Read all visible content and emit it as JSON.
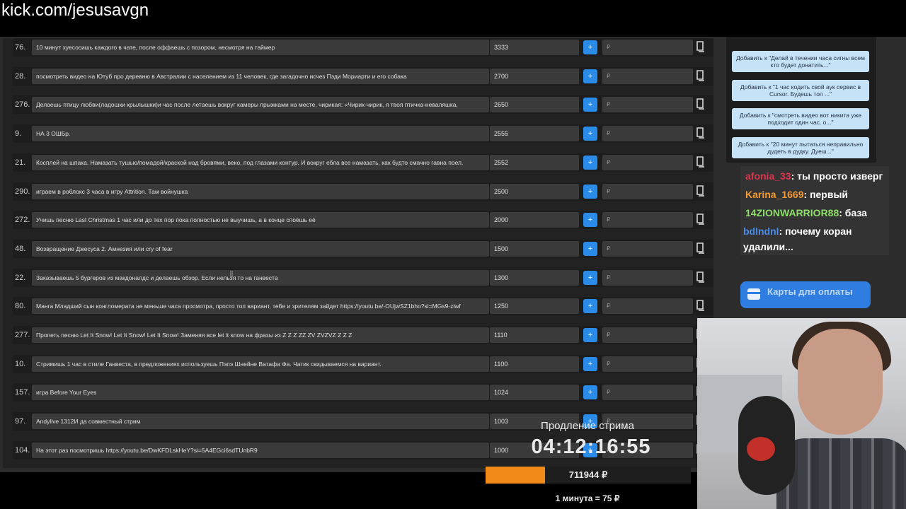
{
  "browser": {
    "url": "kick.com/jesusavgn"
  },
  "auction": {
    "currency_placeholder": "₽",
    "add_label": "+",
    "lots": [
      {
        "num": "76.",
        "name": "10 минут хуесосишь каждого в чате, после оффаешь с позором, несмотря на таймер",
        "amount": "3333"
      },
      {
        "num": "28.",
        "name": "посмотреть видео на Ютуб про деревню в Австралии с населением из 11 человек, где загадочно исчез Пэди Мориарти и его собака",
        "amount": "2700"
      },
      {
        "num": "276.",
        "name": "Делаешь птицу любви(ладошки крылышки)и час после летаешь вокруг камеры прыжками на месте, чирикая: «Чирик-чирик, я твоя птичка-неваляшка, ",
        "amount": "2650"
      },
      {
        "num": "9.",
        "name": "НА 3 ОШБр.",
        "amount": "2555"
      },
      {
        "num": "21.",
        "name": "Косплей на шпака. Намазать тушью/помадой/краской над бровями, веко, под глазами контур. И вокруг ебла все намазать, как будто смачно гавна поел.",
        "amount": "2552"
      },
      {
        "num": "290.",
        "name": "играем в роблокс 3 часа в игру Attrition. Там войнушка",
        "amount": "2500"
      },
      {
        "num": "272.",
        "name": "Учишь песню Last Christmas 1 час или до тех пор пока полностью не выучишь, а в конце споёшь её",
        "amount": "2000"
      },
      {
        "num": "48.",
        "name": "Возвращение Джесуса 2. Амнезия или cry of fear",
        "amount": "1500"
      },
      {
        "num": "22.",
        "name": "Заказываешь 5 бургеров из макдоналдс и делаешь обзор. Если нельзя то на ганвеста",
        "amount": "1300"
      },
      {
        "num": "80.",
        "name": "Манга Младший сын конгломерата не меньше часа просмотра, просто топ вариант, тебе и зрителям зайдет https://youtu.be/-OUjwSZ1bho?si=MGs9-ziwf",
        "amount": "1250"
      },
      {
        "num": "277.",
        "name": "Пропеть песню Let It Snow! Let It Snow! Let It Snow! Заменяя все let it snow на фразы из Z Z Z ZZ ZV ZVZVZ Z Z Z",
        "amount": "1110"
      },
      {
        "num": "10.",
        "name": "Стримишь 1 час в стиле Ганвеста, в предложениях используешь Пэпэ Шнейне Ватафа Фа. Чатик скидываемся на вариант.",
        "amount": "1100"
      },
      {
        "num": "157.",
        "name": "игра Before Your Eyes",
        "amount": "1024"
      },
      {
        "num": "97.",
        "name": "Andylive 1312И да совместный стрим",
        "amount": "1003"
      },
      {
        "num": "104.",
        "name": "На этот раз посмотришь https://youtu.be/DwKFDLskHeY?si=5A4EGci6sdTUnbR9",
        "amount": "1000"
      }
    ]
  },
  "suggestions": [
    "Добавить к \"Делай в течении часа сигны всем кто будет донатить...\"",
    "Добавить к \"1 час кодить свой аук сервис в Cursor. Будешь топ ...\"",
    "Добавить к \"смотреть видео вот никита уже подходит один час. о...\"",
    "Добавить к \"20 минут пытаться неправильно дудеть в дудку. Дуеш...\""
  ],
  "chat": {
    "messages": [
      {
        "user": "afonia_33",
        "text": ": ты просто изверг",
        "color": "#e0344d"
      },
      {
        "user": "Karina_1669",
        "text": ": первый",
        "color": "#f39a33"
      },
      {
        "user": "14ZIONWARRIOR88",
        "text": ": база",
        "color": "#8ee06a"
      },
      {
        "user": "bdlndnl",
        "text": ": почему коран удалили...",
        "color": "#4a8be8"
      }
    ]
  },
  "payment": {
    "label": "Карты для оплаты",
    "icon": "card-icon"
  },
  "stream": {
    "timer_label": "Продление стрима",
    "timer": "04:12:16:55",
    "total": "711944 ₽",
    "progress_fraction": 0.29,
    "rate": "1 минута = 75 ₽"
  }
}
